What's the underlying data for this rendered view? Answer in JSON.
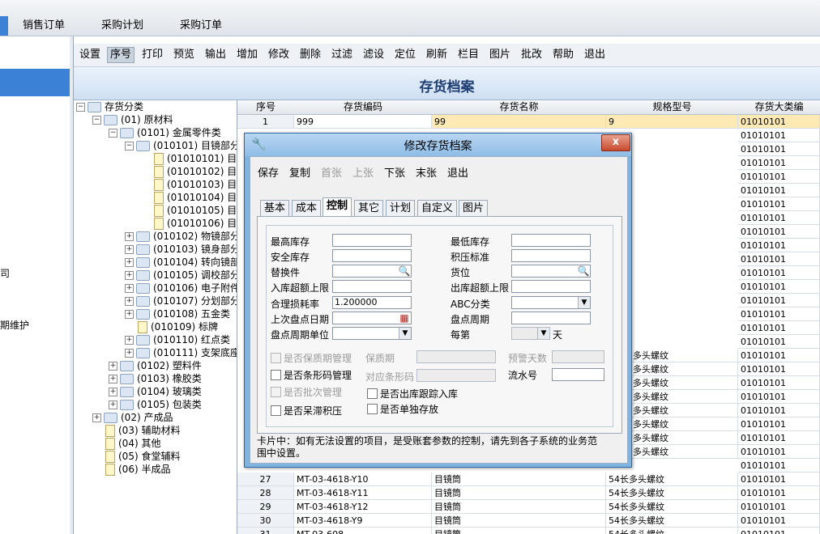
{
  "top_tabs": [
    {
      "label": "销售订单"
    },
    {
      "label": "采购计划"
    },
    {
      "label": "采购订单"
    }
  ],
  "left_nav": {
    "items": [
      {
        "label": "司"
      },
      {
        "label": "期维护"
      }
    ]
  },
  "toolbar": {
    "items": [
      {
        "label": "设置"
      },
      {
        "label": "序号"
      },
      {
        "label": "打印"
      },
      {
        "label": "预览"
      },
      {
        "label": "输出"
      },
      {
        "label": "增加"
      },
      {
        "label": "修改"
      },
      {
        "label": "删除"
      },
      {
        "label": "过滤"
      },
      {
        "label": "滤设"
      },
      {
        "label": "定位"
      },
      {
        "label": "刷新"
      },
      {
        "label": "栏目"
      },
      {
        "label": "图片"
      },
      {
        "label": "批改"
      },
      {
        "label": "帮助"
      },
      {
        "label": "退出"
      }
    ]
  },
  "page_title": "存货档案",
  "tree": {
    "nodes": [
      {
        "label": "存货分类"
      },
      {
        "label": "(01) 原材料"
      },
      {
        "label": "(0101) 金属零件类"
      },
      {
        "label": "(010101) 目镜部分"
      },
      {
        "label": "(01010101) 目"
      },
      {
        "label": "(01010102) 目"
      },
      {
        "label": "(01010103) 目"
      },
      {
        "label": "(01010104) 目"
      },
      {
        "label": "(01010105) 目"
      },
      {
        "label": "(01010106) 目"
      },
      {
        "label": "(010102) 物镜部分"
      },
      {
        "label": "(010103) 镜身部分"
      },
      {
        "label": "(010104) 转向镜部"
      },
      {
        "label": "(010105) 调校部分"
      },
      {
        "label": "(010106) 电子附件"
      },
      {
        "label": "(010107) 分划部分"
      },
      {
        "label": "(010108) 五金类"
      },
      {
        "label": "(010109) 标牌"
      },
      {
        "label": "(010110) 红点类"
      },
      {
        "label": "(010111) 支架底座"
      },
      {
        "label": "(0102) 塑料件"
      },
      {
        "label": "(0103) 橡胶类"
      },
      {
        "label": "(0104) 玻璃类"
      },
      {
        "label": "(0105) 包装类"
      },
      {
        "label": "(02) 产成品"
      },
      {
        "label": "(03) 辅助材料"
      },
      {
        "label": "(04) 其他"
      },
      {
        "label": "(05) 食堂辅料"
      },
      {
        "label": "(06) 半成品"
      }
    ]
  },
  "grid": {
    "headers": [
      "序号",
      "存货编码",
      "存货名称",
      "规格型号",
      "存货大类编"
    ],
    "top_rows": [
      {
        "no": "1",
        "code": "999",
        "name": "99",
        "spec": "9",
        "cat": "01010101"
      }
    ],
    "cat_column": [
      "01010101",
      "01010101",
      "01010101",
      "01010101",
      "01010101",
      "01010101",
      "01010101",
      "01010101",
      "01010101",
      "01010101",
      "01010101",
      "01010101",
      "01010101",
      "01010101",
      "01010101",
      "01010101",
      "01010101",
      "01010101",
      "01010101",
      "01010101",
      "01010101",
      "01010101",
      "01010101",
      "01010101",
      "01010101",
      "01010101",
      "01010101",
      "01010101",
      "01010101",
      "01010101"
    ],
    "spec_partial": [
      "多头螺纹",
      "多头螺纹",
      "多头螺纹",
      "多头螺纹",
      "多头螺纹",
      "多头螺纹",
      "多头螺纹",
      "多头螺纹"
    ],
    "bottom_rows": [
      {
        "no": "27",
        "code": "MT-03-4618-Y10",
        "name": "目镜筒",
        "spec": "54长多头螺纹",
        "cat": "01010101"
      },
      {
        "no": "28",
        "code": "MT-03-4618-Y11",
        "name": "目镜筒",
        "spec": "54长多头螺纹",
        "cat": "01010101"
      },
      {
        "no": "29",
        "code": "MT-03-4618-Y12",
        "name": "目镜筒",
        "spec": "54长多头螺纹",
        "cat": "01010101"
      },
      {
        "no": "30",
        "code": "MT-03-4618-Y9",
        "name": "目镜筒",
        "spec": "54长多头螺纹",
        "cat": "01010101"
      },
      {
        "no": "31",
        "code": "MT-03-608",
        "name": "目镜筒",
        "spec": "54长多头螺纹",
        "cat": "01010101"
      }
    ]
  },
  "dialog": {
    "title": "修改存货档案",
    "close": "x",
    "toolbar": [
      {
        "label": "保存"
      },
      {
        "label": "复制"
      },
      {
        "label": "首张"
      },
      {
        "label": "上张"
      },
      {
        "label": "下张"
      },
      {
        "label": "末张"
      },
      {
        "label": "退出"
      }
    ],
    "tabs": [
      {
        "label": "基本"
      },
      {
        "label": "成本"
      },
      {
        "label": "控制"
      },
      {
        "label": "其它"
      },
      {
        "label": "计划"
      },
      {
        "label": "自定义"
      },
      {
        "label": "图片"
      }
    ],
    "fields": {
      "max_stock": "最高库存",
      "min_stock": "最低库存",
      "safety_stock": "安全库存",
      "overstock_std": "积压标准",
      "substitute": "替换件",
      "location": "货位",
      "inbound_limit": "入库超额上限",
      "outbound_limit": "出库超额上限",
      "loss_rate": "合理损耗率",
      "loss_rate_value": "1.200000",
      "abc": "ABC分类",
      "last_count_date": "上次盘点日期",
      "count_cycle": "盘点周期",
      "count_cycle_unit": "盘点周期单位",
      "every": "每第",
      "day": "天",
      "shelf_mgmt": "是否保质期管理",
      "shelf_life": "保质期",
      "warn_days": "预警天数",
      "barcode_mgmt": "是否条形码管理",
      "barcode": "对应条形码",
      "serial": "流水号",
      "batch_mgmt": "是否批次管理",
      "out_track_in": "是否出库跟踪入库",
      "stagnant": "是否呆滞积压",
      "separate_store": "是否单独存放"
    },
    "note": "卡片中：如有无法设置的项目，是受账套参数的控制，请先到各子系统的业务范围中设置。"
  }
}
